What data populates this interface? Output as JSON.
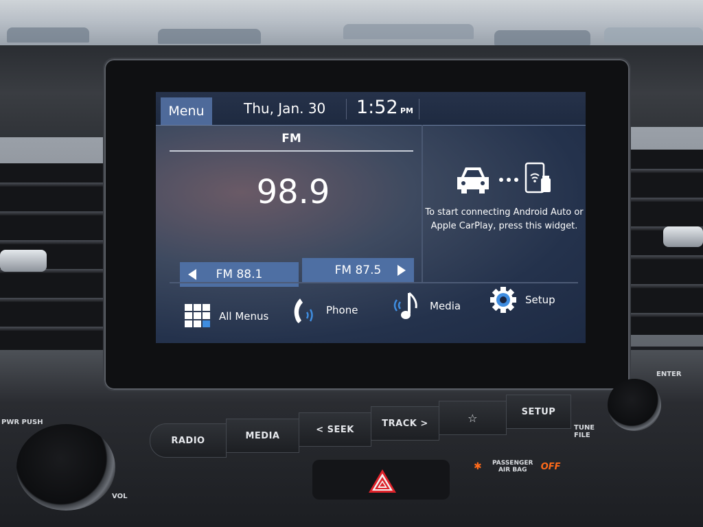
{
  "screen": {
    "topbar": {
      "menu_label": "Menu",
      "date": "Thu, Jan. 30",
      "time": "1:52",
      "ampm": "PM"
    },
    "radio": {
      "band": "FM",
      "frequency": "98.9",
      "presets": [
        {
          "label": "FM 88.1",
          "arrow": "left"
        },
        {
          "label": "FM 87.5",
          "arrow": "right"
        }
      ]
    },
    "carplay_widget": {
      "icons": [
        "car-icon",
        "dots-icon",
        "phone-wireless-usb-icon"
      ],
      "text": "To start connecting Android Auto or Apple CarPlay, press this widget."
    },
    "bottom_nav": [
      {
        "label": "All Menus",
        "icon": "grid-icon"
      },
      {
        "label": "Phone",
        "icon": "phone-icon"
      },
      {
        "label": "Media",
        "icon": "music-note-icon"
      },
      {
        "label": "Setup",
        "icon": "gear-icon"
      }
    ],
    "accent_color": "#4e6fa3"
  },
  "hardware": {
    "buttons": [
      "RADIO",
      "MEDIA",
      "< SEEK",
      "TRACK >",
      "☆",
      "SETUP"
    ],
    "labels": {
      "power": "PWR PUSH",
      "volume": "VOL",
      "tune": "TUNE FILE",
      "enter": "ENTER",
      "airbag": "PASSENGER AIR BAG",
      "airbag_status": "OFF"
    },
    "airbag_status_color": "#ff6a1a",
    "hazard_color": "#e0232b"
  }
}
